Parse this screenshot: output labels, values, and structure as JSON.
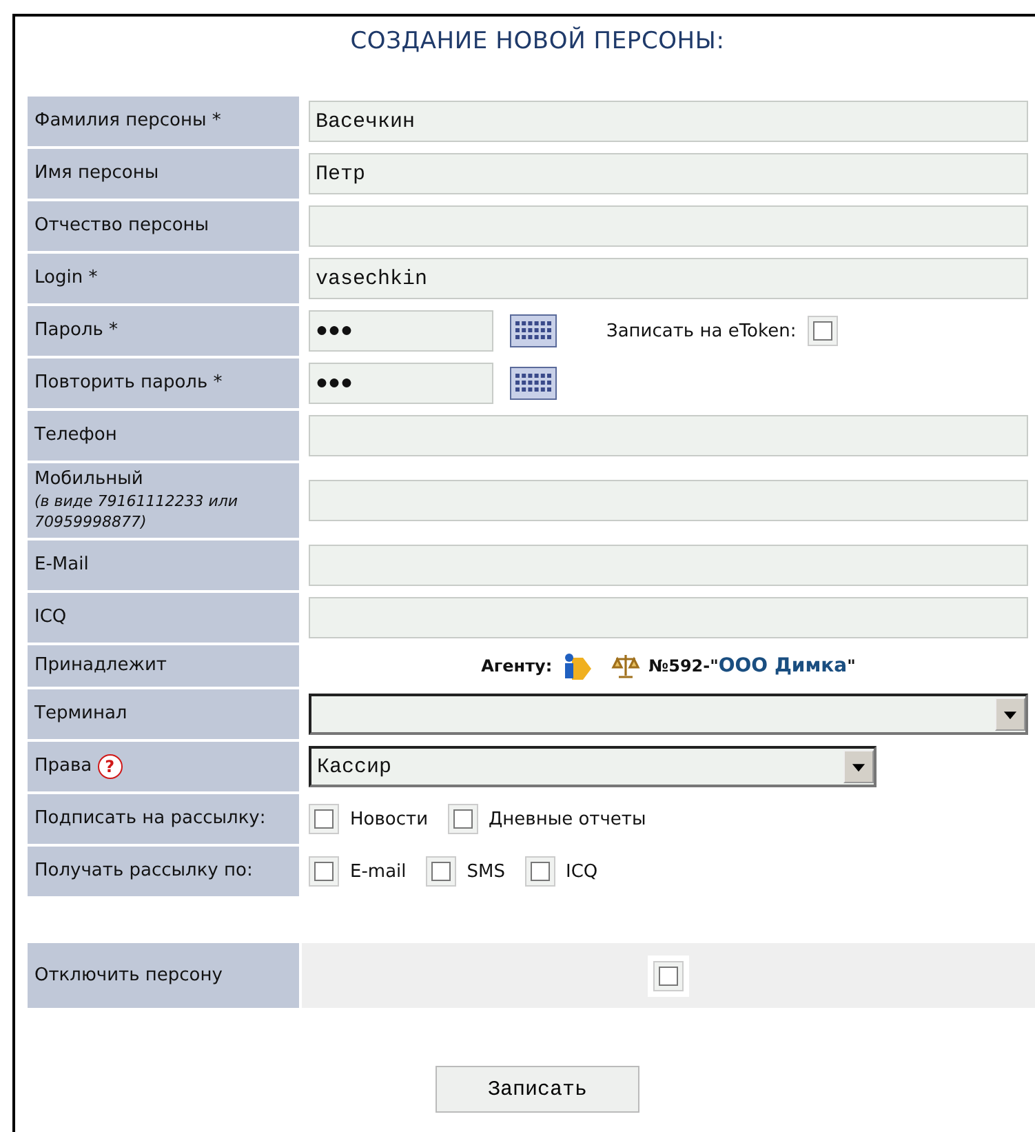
{
  "title": "СОЗДАНИЕ НОВОЙ ПЕРСОНЫ:",
  "fields": [
    {
      "kind": "text",
      "label": "Фамилия персоны *",
      "value": "Васечкин"
    },
    {
      "kind": "text",
      "label": "Имя персоны",
      "value": "Петр"
    },
    {
      "kind": "text",
      "label": "Отчество персоны"
    },
    {
      "kind": "text",
      "label": "Login *",
      "value": "vasechkin"
    },
    {
      "kind": "password",
      "label": "Пароль *",
      "value": "●●●",
      "token": {
        "label": "Записать на eToken:",
        "checked": false
      }
    },
    {
      "kind": "password",
      "label": "Повторить пароль *",
      "value": "●●●"
    },
    {
      "kind": "text",
      "label": "Телефон"
    },
    {
      "kind": "text",
      "label": "Мобильный",
      "note": "(в виде 79161112233 или 70959998877)"
    },
    {
      "kind": "text",
      "label": "E-Mail"
    },
    {
      "kind": "text",
      "label": "ICQ"
    },
    {
      "kind": "agent",
      "label": "Принадлежит",
      "prefix": "Агенту:",
      "number": "№592-\"",
      "link": "ООО Димка",
      "suffix": "\""
    },
    {
      "kind": "select",
      "label": "Терминал",
      "wide": true
    },
    {
      "kind": "select",
      "label": "Права",
      "help": "?",
      "value": "Кассир",
      "wide": false
    },
    {
      "kind": "checks",
      "label": "Подписать на рассылку:",
      "options": [
        {
          "label": "Новости",
          "checked": false
        },
        {
          "label": "Дневные отчеты",
          "checked": false
        }
      ]
    },
    {
      "kind": "checks",
      "label": "Получать рассылку по:",
      "options": [
        {
          "label": "E-mail",
          "checked": false
        },
        {
          "label": "SMS",
          "checked": false
        },
        {
          "label": "ICQ",
          "checked": false
        }
      ]
    }
  ],
  "disable": {
    "label": "Отключить персону",
    "checked": false
  },
  "submit": "Записать"
}
